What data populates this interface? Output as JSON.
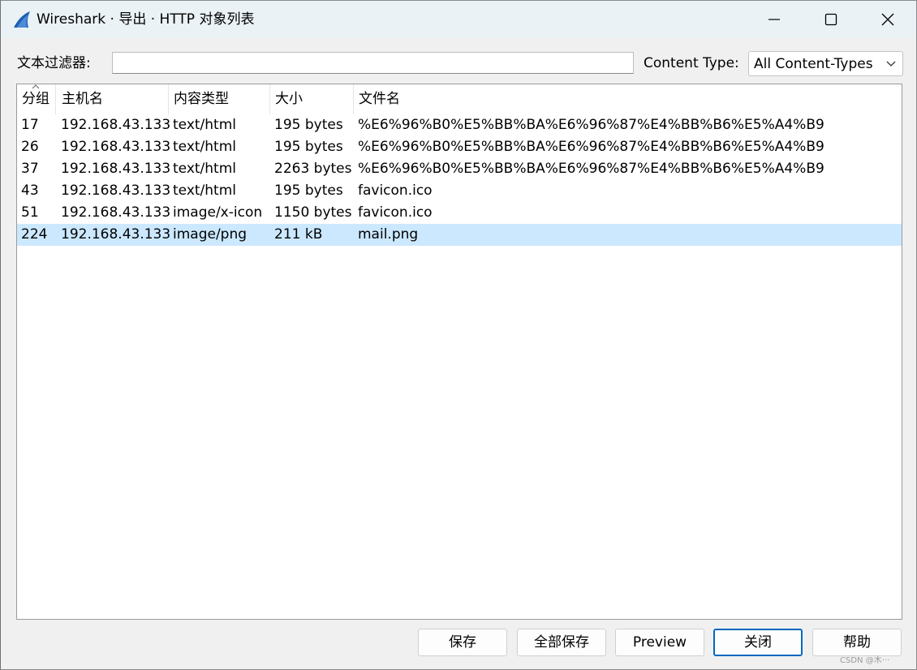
{
  "window": {
    "title": "Wireshark · 导出 · HTTP 对象列表"
  },
  "filter": {
    "label": "文本过滤器:",
    "value": "",
    "content_type_label": "Content Type:",
    "content_type_value": "All Content-Types"
  },
  "table": {
    "columns": [
      "分组",
      "主机名",
      "内容类型",
      "大小",
      "文件名"
    ],
    "sort_column": "分组",
    "rows": [
      {
        "packet": "17",
        "hostname": "192.168.43.133",
        "content_type": "text/html",
        "size": "195 bytes",
        "filename": "%E6%96%B0%E5%BB%BA%E6%96%87%E4%BB%B6%E5%A4%B9"
      },
      {
        "packet": "26",
        "hostname": "192.168.43.133",
        "content_type": "text/html",
        "size": "195 bytes",
        "filename": "%E6%96%B0%E5%BB%BA%E6%96%87%E4%BB%B6%E5%A4%B9"
      },
      {
        "packet": "37",
        "hostname": "192.168.43.133",
        "content_type": "text/html",
        "size": "2263 bytes",
        "filename": "%E6%96%B0%E5%BB%BA%E6%96%87%E4%BB%B6%E5%A4%B9"
      },
      {
        "packet": "43",
        "hostname": "192.168.43.133",
        "content_type": "text/html",
        "size": "195 bytes",
        "filename": "favicon.ico"
      },
      {
        "packet": "51",
        "hostname": "192.168.43.133",
        "content_type": "image/x-icon",
        "size": "1150 bytes",
        "filename": "favicon.ico"
      },
      {
        "packet": "224",
        "hostname": "192.168.43.133",
        "content_type": "image/png",
        "size": "211 kB",
        "filename": "mail.png"
      }
    ],
    "selected_row_index": 5
  },
  "buttons": {
    "save": "保存",
    "save_all": "全部保存",
    "preview": "Preview",
    "close": "关闭",
    "help": "帮助"
  },
  "watermark": "CSDN @木···",
  "colors": {
    "selection": "#cce8ff",
    "titlebar": "#eaf2f6",
    "accent": "#0067c0"
  }
}
